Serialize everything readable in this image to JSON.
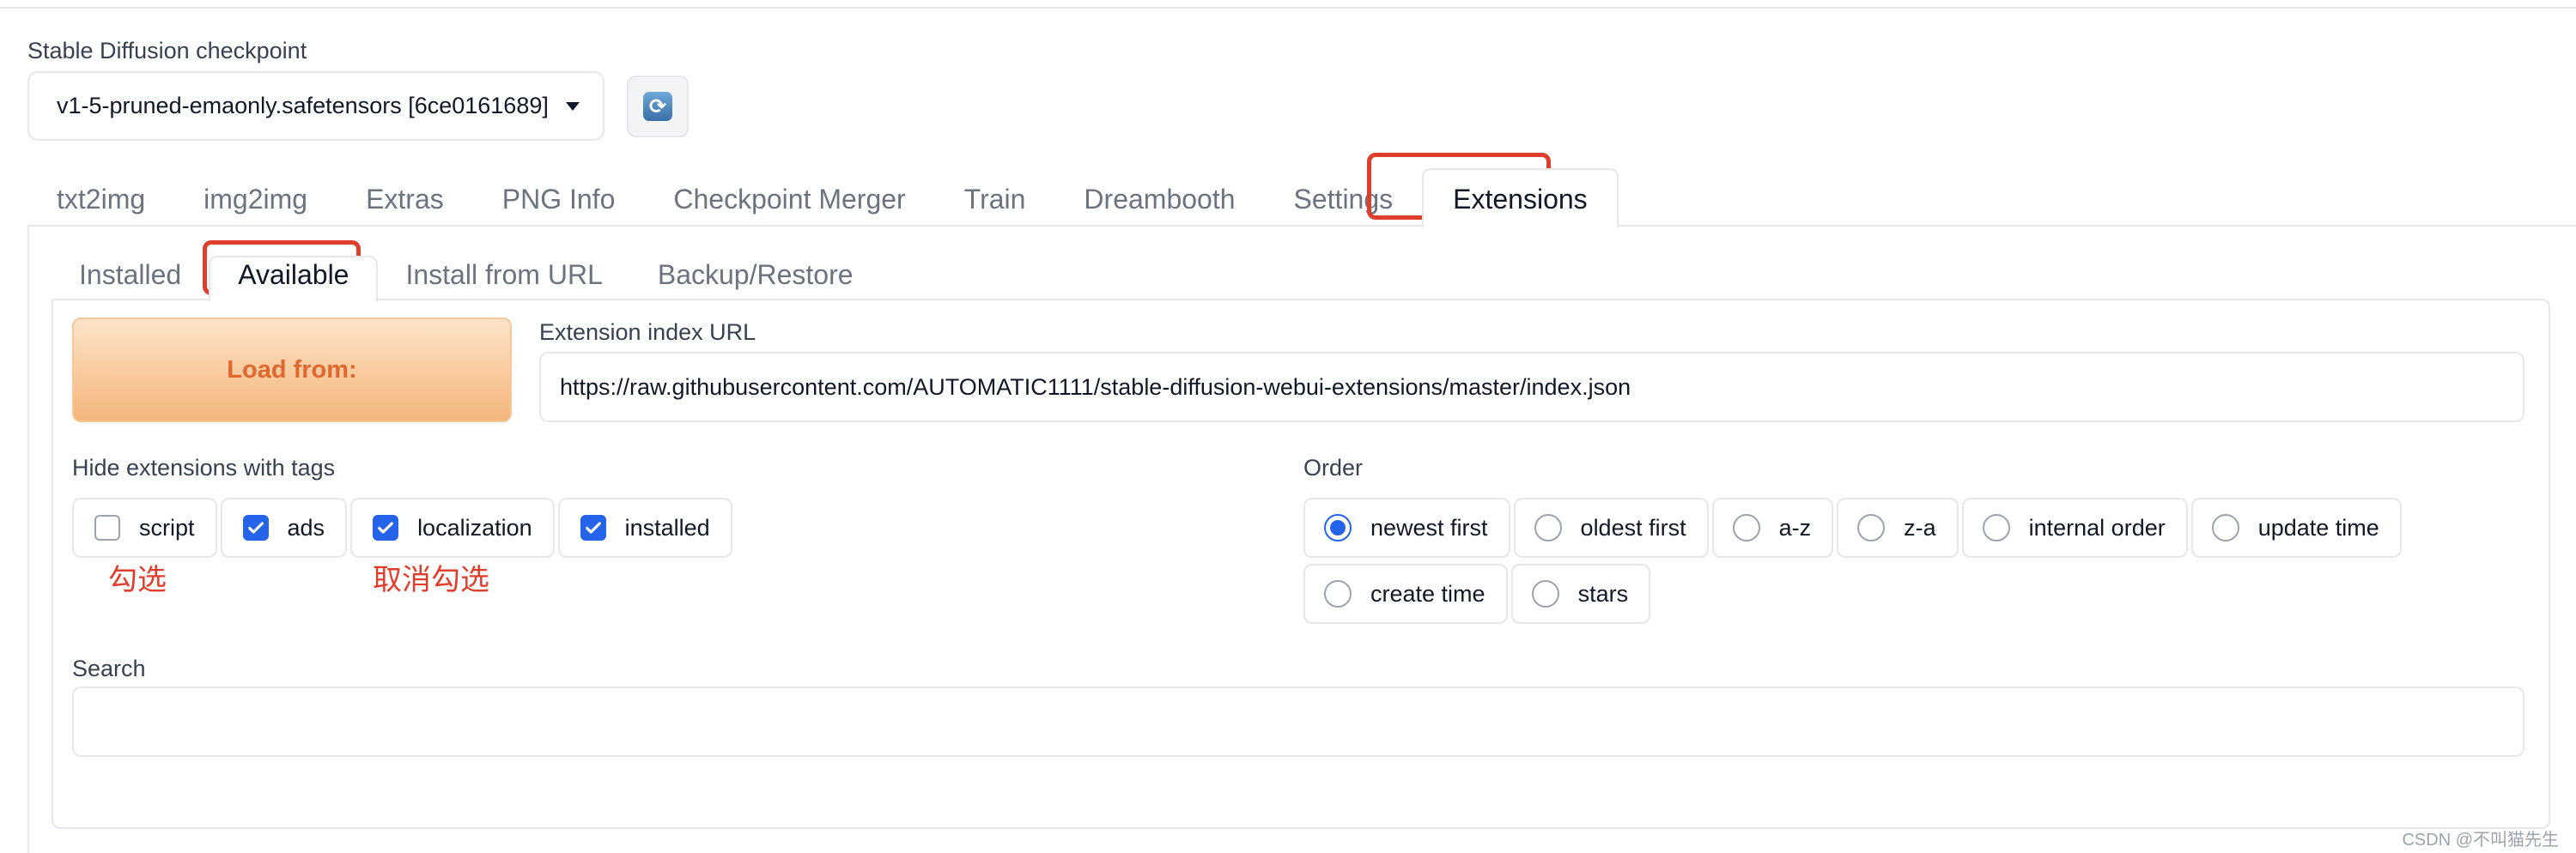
{
  "checkpoint": {
    "label": "Stable Diffusion checkpoint",
    "value": "v1-5-pruned-emaonly.safetensors [6ce0161689]"
  },
  "main_tabs": [
    {
      "label": "txt2img"
    },
    {
      "label": "img2img"
    },
    {
      "label": "Extras"
    },
    {
      "label": "PNG Info"
    },
    {
      "label": "Checkpoint Merger"
    },
    {
      "label": "Train"
    },
    {
      "label": "Dreambooth"
    },
    {
      "label": "Settings"
    },
    {
      "label": "Extensions",
      "active": true
    }
  ],
  "sub_tabs": [
    {
      "label": "Installed"
    },
    {
      "label": "Available",
      "active": true
    },
    {
      "label": "Install from URL"
    },
    {
      "label": "Backup/Restore"
    }
  ],
  "load_button": "Load from:",
  "index_url": {
    "label": "Extension index URL",
    "value": "https://raw.githubusercontent.com/AUTOMATIC1111/stable-diffusion-webui-extensions/master/index.json"
  },
  "hide_tags": {
    "label": "Hide extensions with tags",
    "items": [
      {
        "label": "script",
        "checked": false
      },
      {
        "label": "ads",
        "checked": true
      },
      {
        "label": "localization",
        "checked": true
      },
      {
        "label": "installed",
        "checked": true
      }
    ]
  },
  "annotations": {
    "check": "勾选",
    "uncheck": "取消勾选"
  },
  "order": {
    "label": "Order",
    "options": [
      {
        "label": "newest first",
        "selected": true
      },
      {
        "label": "oldest first",
        "selected": false
      },
      {
        "label": "a-z",
        "selected": false
      },
      {
        "label": "z-a",
        "selected": false
      },
      {
        "label": "internal order",
        "selected": false
      },
      {
        "label": "update time",
        "selected": false
      },
      {
        "label": "create time",
        "selected": false
      },
      {
        "label": "stars",
        "selected": false
      }
    ]
  },
  "search": {
    "label": "Search",
    "value": ""
  },
  "watermark": "CSDN @不叫猫先生",
  "colors": {
    "highlight": "#e03e2d",
    "accent": "#2563eb",
    "load_text": "#e0672d"
  }
}
